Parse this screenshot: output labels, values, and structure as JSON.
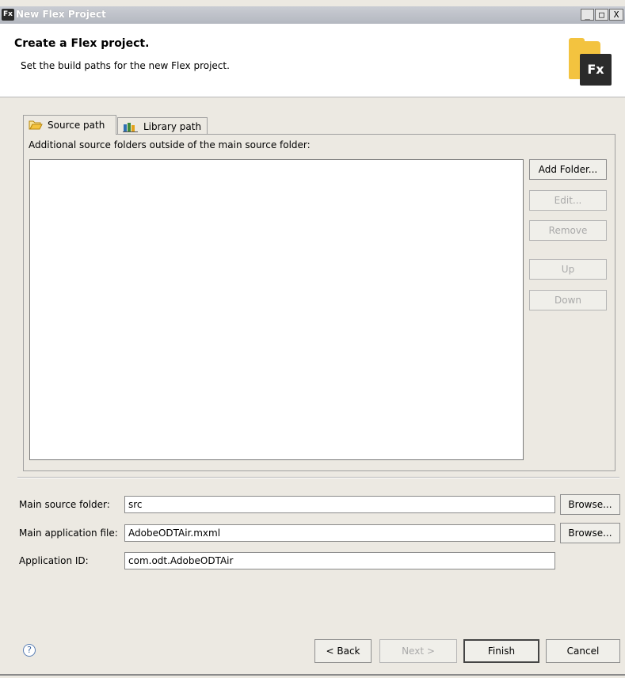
{
  "window": {
    "title": "New Flex Project",
    "app_icon": "Fx",
    "controls": {
      "minimize": "_",
      "maximize": "□",
      "close": "X"
    }
  },
  "header": {
    "title": "Create a Flex project.",
    "description": "Set the build paths for the new Flex project.",
    "badge": "Fx"
  },
  "tabs": [
    {
      "label": "Source path",
      "icon": "folder-open-icon",
      "active": true
    },
    {
      "label": "Library path",
      "icon": "library-books-icon",
      "active": false
    }
  ],
  "source_panel": {
    "label": "Additional source folders outside of the main source folder:",
    "items": [],
    "buttons": {
      "add_folder": "Add Folder...",
      "edit": "Edit...",
      "remove": "Remove",
      "up": "Up",
      "down": "Down"
    }
  },
  "fields": {
    "main_source_folder": {
      "label": "Main source folder:",
      "value": "src",
      "browse": "Browse..."
    },
    "main_application_file": {
      "label": "Main application file:",
      "value": "AdobeODTAir.mxml",
      "browse": "Browse..."
    },
    "application_id": {
      "label": "Application ID:",
      "value": "com.odt.AdobeODTAir"
    }
  },
  "footer": {
    "help": "?",
    "back": "< Back",
    "next": "Next >",
    "finish": "Finish",
    "cancel": "Cancel"
  },
  "colors": {
    "dialog_bg": "#ece9e2",
    "header_bg": "#ffffff",
    "titlebar": "#b4b8c0",
    "fx_yellow": "#f3c33f",
    "fx_dark": "#2b2b2b"
  }
}
